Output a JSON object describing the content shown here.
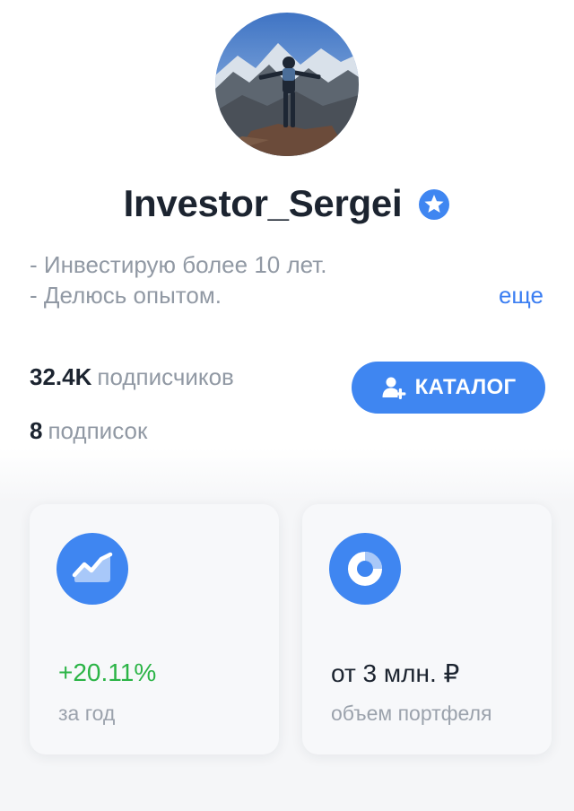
{
  "profile": {
    "username": "Investor_Sergei",
    "avatar_icon": "profile-photo-mountains",
    "verified_icon": "star-badge-icon",
    "bio_lines": [
      "- Инвестирую более 10 лет.",
      "- Делюсь опытом."
    ],
    "more_label": "еще"
  },
  "stats": {
    "followers_count": "32.4K",
    "followers_label": "подписчиков",
    "following_count": "8",
    "following_label": "подписок"
  },
  "catalog_button": {
    "label": "КАТАЛОГ",
    "icon": "add-user-icon"
  },
  "cards": [
    {
      "icon": "trend-chart-icon",
      "value": "+20.11%",
      "label": "за год",
      "value_color": "#2bb446"
    },
    {
      "icon": "donut-chart-icon",
      "value": "от 3 млн. ₽",
      "label": "объем портфеля",
      "value_color": "#1c2430"
    }
  ],
  "colors": {
    "accent": "#3f86f1",
    "link": "#3b7ef2",
    "positive": "#2bb446",
    "text_primary": "#1c2430",
    "text_secondary": "#9199a4"
  }
}
